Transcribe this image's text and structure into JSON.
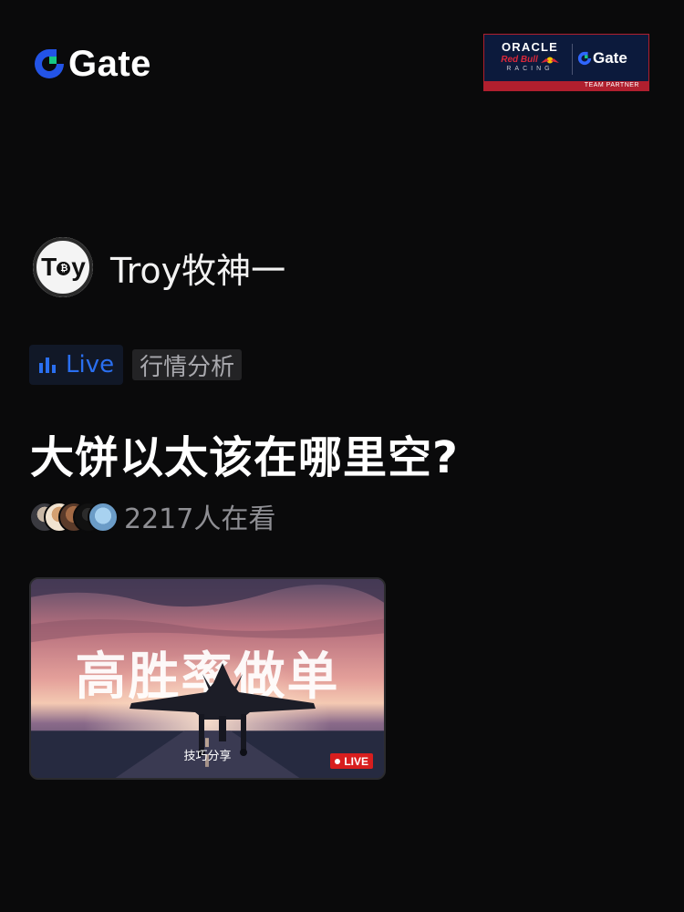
{
  "brand": {
    "name": "Gate"
  },
  "partner": {
    "oracle": "ORACLE",
    "redbull": "Red Bull",
    "racing": "RACING",
    "gate": "Gate",
    "strip": "TEAM PARTNER"
  },
  "host": {
    "name": "Troy牧神一"
  },
  "tags": {
    "live": "Live",
    "category": "行情分析"
  },
  "title": "大饼以太该在哪里空?",
  "viewers": {
    "count_text": "2217人在看"
  },
  "card": {
    "headline": "高胜率做单",
    "subtitle": "技巧分享",
    "live_badge": "LIVE"
  },
  "colors": {
    "accent_blue": "#2a6ff0",
    "live_red": "#d81e1e",
    "background": "#0a0a0b"
  }
}
